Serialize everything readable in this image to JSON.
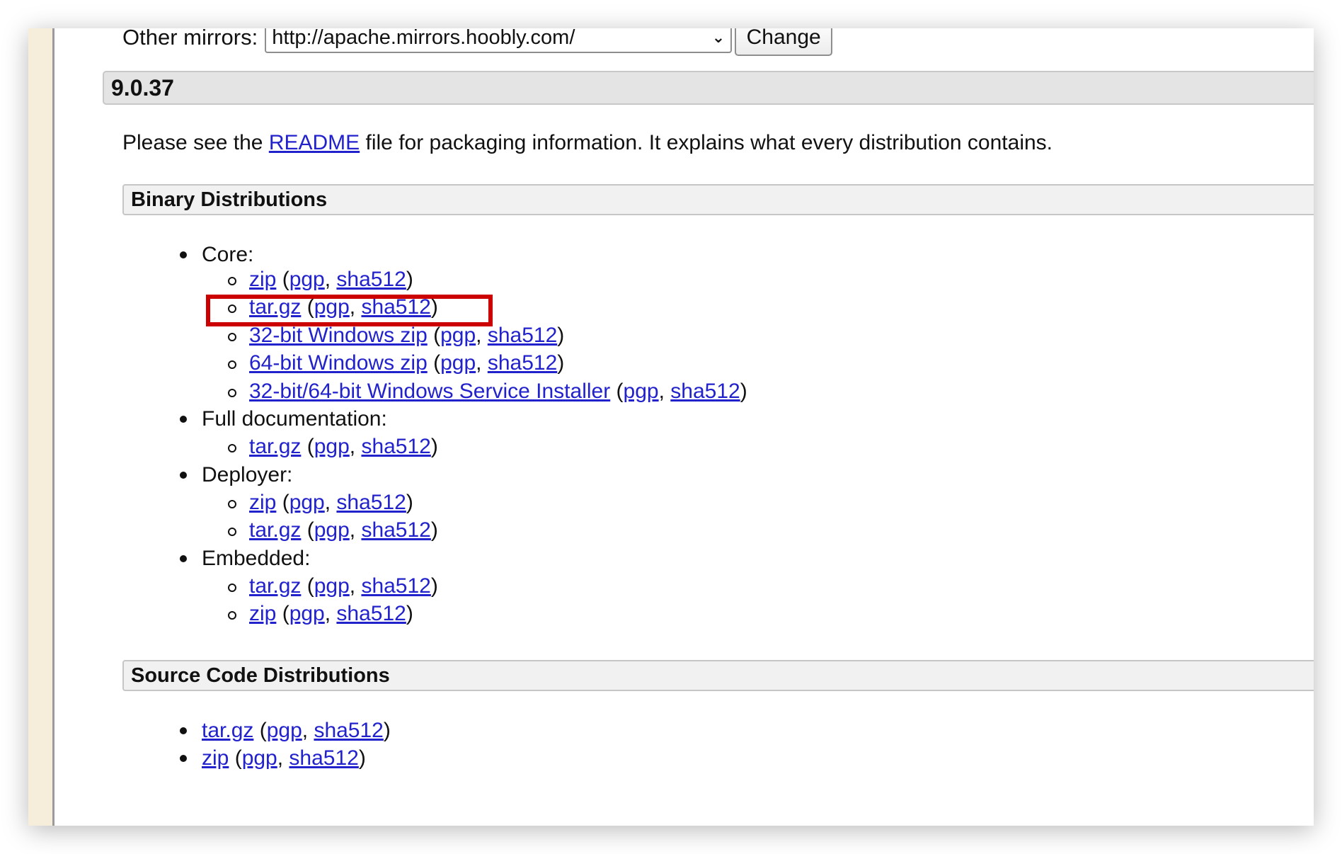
{
  "mirror": {
    "label": "Other mirrors:",
    "selected": "http://apache.mirrors.hoobly.com/",
    "change_label": "Change"
  },
  "version": "9.0.37",
  "intro": {
    "before": "Please see the ",
    "readme": "README",
    "after": " file for packaging information. It explains what every distribution contains."
  },
  "binary": {
    "heading": "Binary Distributions",
    "core_label": "Core:",
    "core_items": [
      {
        "name": "zip",
        "sig": "pgp",
        "hash": "sha512"
      },
      {
        "name": "tar.gz",
        "sig": "pgp",
        "hash": "sha512"
      },
      {
        "name": "32-bit Windows zip",
        "sig": "pgp",
        "hash": "sha512"
      },
      {
        "name": "64-bit Windows zip",
        "sig": "pgp",
        "hash": "sha512"
      },
      {
        "name": "32-bit/64-bit Windows Service Installer",
        "sig": "pgp",
        "hash": "sha512"
      }
    ],
    "docs_label": "Full documentation:",
    "docs_items": [
      {
        "name": "tar.gz",
        "sig": "pgp",
        "hash": "sha512"
      }
    ],
    "deployer_label": "Deployer:",
    "deployer_items": [
      {
        "name": "zip",
        "sig": "pgp",
        "hash": "sha512"
      },
      {
        "name": "tar.gz",
        "sig": "pgp",
        "hash": "sha512"
      }
    ],
    "embedded_label": "Embedded:",
    "embedded_items": [
      {
        "name": "tar.gz",
        "sig": "pgp",
        "hash": "sha512"
      },
      {
        "name": "zip",
        "sig": "pgp",
        "hash": "sha512"
      }
    ]
  },
  "source": {
    "heading": "Source Code Distributions",
    "items": [
      {
        "name": "tar.gz",
        "sig": "pgp",
        "hash": "sha512"
      },
      {
        "name": "zip",
        "sig": "pgp",
        "hash": "sha512"
      }
    ]
  },
  "punct": {
    "open": " (",
    "comma": ", ",
    "close": ")"
  }
}
